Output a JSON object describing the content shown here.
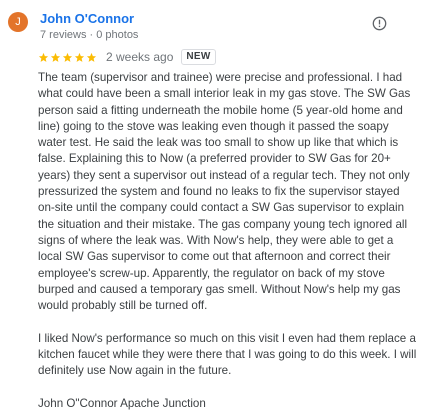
{
  "review": {
    "author": {
      "initial": "J",
      "name": "John O'Connor",
      "meta": "7 reviews · 0 photos",
      "avatar_color": "#e3742a"
    },
    "menu_icon": "more-options-icon",
    "rating": {
      "stars": 5,
      "max_stars": 5,
      "star_color": "#fbbc04",
      "date": "2 weeks ago",
      "badge": "NEW"
    },
    "paragraphs": [
      "The team (supervisor and trainee) were precise and professional. I had what could have been a small interior leak in my gas stove. The SW Gas person said a fitting underneath the mobile home (5 year-old home and line) going to the stove was leaking even though it passed the soapy water test. He said the leak was too small to show up like that which is false. Explaining this to Now (a preferred provider to SW Gas for 20+ years) they sent a supervisor out instead of a regular tech. They not only pressurized the system and found no leaks to fix the supervisor stayed on-site until the company could contact a SW Gas supervisor to explain the situation and their mistake. The gas company young tech ignored all signs of where the leak was. With Now's help, they were able to get a local SW Gas supervisor to come out that afternoon and correct their employee's screw-up. Apparently, the regulator on back of my stove burped and caused a temporary gas smell. Without Now's help my gas would probably still be turned off.",
      "I liked Now's performance so much on this visit I even had them replace a kitchen faucet while they were there that I was going to do this week. I will definitely use Now again in the future.",
      "John O\"Connor Apache Junction"
    ]
  }
}
